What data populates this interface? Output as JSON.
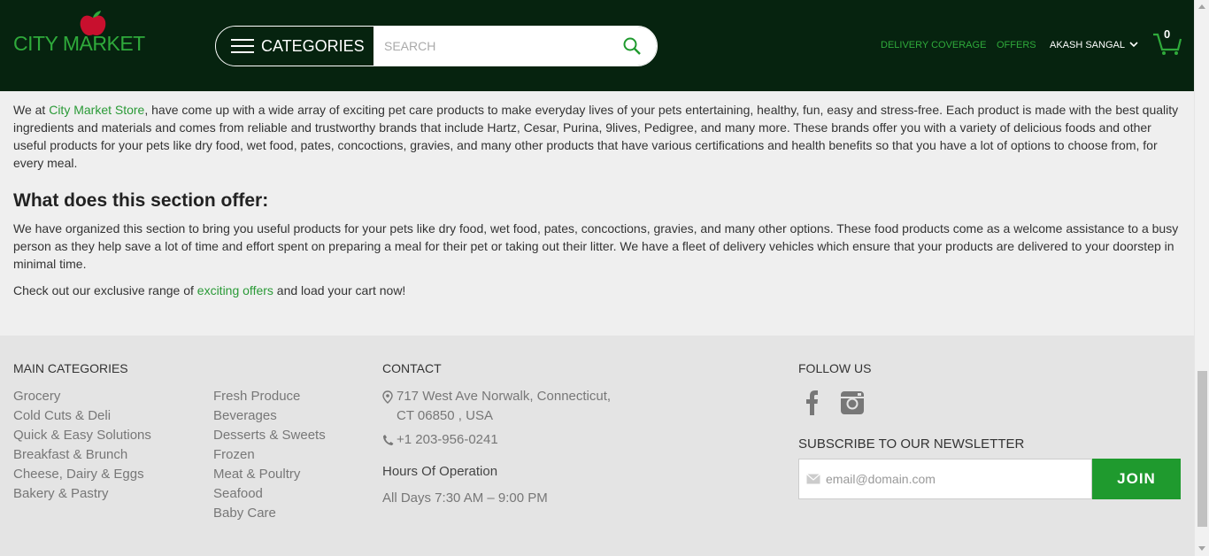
{
  "header": {
    "logo_text": "CITY MARKET",
    "categories_label": "CATEGORIES",
    "search_placeholder": "SEARCH",
    "nav": {
      "delivery": "DELIVERY COVERAGE",
      "offers": "OFFERS",
      "user": "AKASH SANGAL"
    },
    "cart_count": "0"
  },
  "content": {
    "p1_a": "We at ",
    "p1_link": "City Market Store",
    "p1_b": ", have come up with a wide array of exciting pet care products to make everyday lives of your pets entertaining, healthy, fun, easy and stress-free. Each product is made with the best quality ingredients and materials and comes from reliable and trustworthy brands that include Hartz, Cesar, Purina, 9lives, Pedigree, and many more. These brands offer you with a variety of delicious foods and other useful products for your pets like dry food, wet food, pates, concoctions, gravies, and many other products that have various certifications and health benefits so that you have a lot of options to choose from, for every meal.",
    "h2": "What does this section offer:",
    "p2": "We have organized this section to bring you useful products for your pets like dry food, wet food, pates, concoctions, gravies, and many other options. These food products come as a welcome assistance to a busy person as they help save a lot of time and effort spent on preparing a meal for their pet or taking out their litter. We have a fleet of delivery vehicles which ensure that your products are delivered to your doorstep in minimal time.",
    "p3_a": "Check out our exclusive range of ",
    "p3_link": "exciting offers",
    "p3_b": " and load your cart now!"
  },
  "footer": {
    "main_categories_title": "MAIN CATEGORIES",
    "col1": [
      "Grocery",
      "Cold Cuts & Deli",
      "Quick & Easy Solutions",
      "Breakfast & Brunch",
      "Cheese, Dairy & Eggs",
      "Bakery & Pastry"
    ],
    "col2": [
      "Fresh Produce",
      "Beverages",
      "Desserts & Sweets",
      "Frozen",
      "Meat & Poultry",
      "Seafood",
      "Baby Care"
    ],
    "contact_title": "CONTACT",
    "address_line1": "717 West Ave Norwalk, Connecticut,",
    "address_line2": "CT 06850 , USA",
    "phone": "+1 203-956-0241",
    "hours_title": "Hours Of Operation",
    "hours": "All Days 7:30 AM – 9:00 PM",
    "follow_title": "FOLLOW US",
    "newsletter_title": "SUBSCRIBE TO OUR NEWSLETTER",
    "email_placeholder": "email@domain.com",
    "join_label": "JOIN"
  },
  "colors": {
    "header_bg": "#06230f",
    "brand_green": "#2faa3b",
    "join_green": "#1f9a2e",
    "apple_red": "#c8102e"
  }
}
